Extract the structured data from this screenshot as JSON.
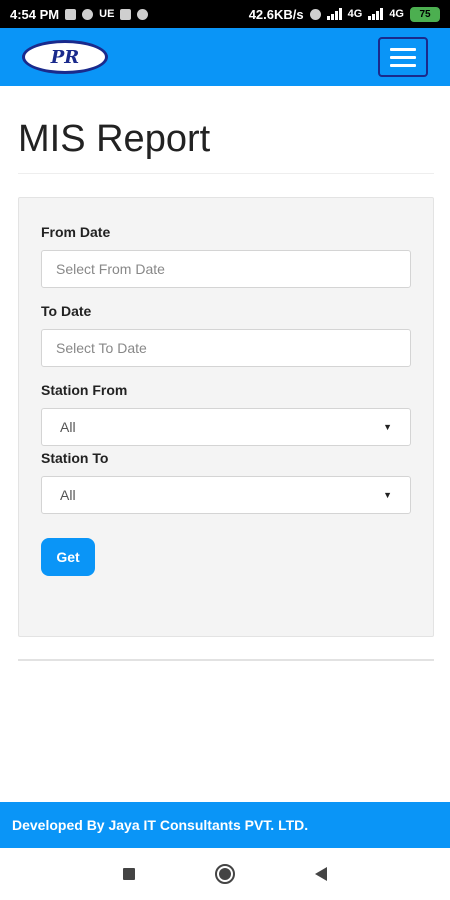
{
  "status_bar": {
    "time": "4:54 PM",
    "speed": "42.6KB/s",
    "network_1": "4G",
    "network_2": "4G",
    "battery": "75"
  },
  "navbar": {
    "logo_text": "PR",
    "menu_icon": "hamburger-menu-icon"
  },
  "page": {
    "title": "MIS Report"
  },
  "form": {
    "from_date_label": "From Date",
    "from_date_placeholder": "Select From Date",
    "to_date_label": "To Date",
    "to_date_placeholder": "Select To Date",
    "station_from_label": "Station From",
    "station_from_value": "All",
    "station_to_label": "Station To",
    "station_to_value": "All",
    "get_button_label": "Get"
  },
  "footer": {
    "text": "Developed By Jaya IT Consultants PVT. LTD."
  },
  "colors": {
    "primary": "#0a95f7",
    "logo_border": "#1a2a8c"
  }
}
